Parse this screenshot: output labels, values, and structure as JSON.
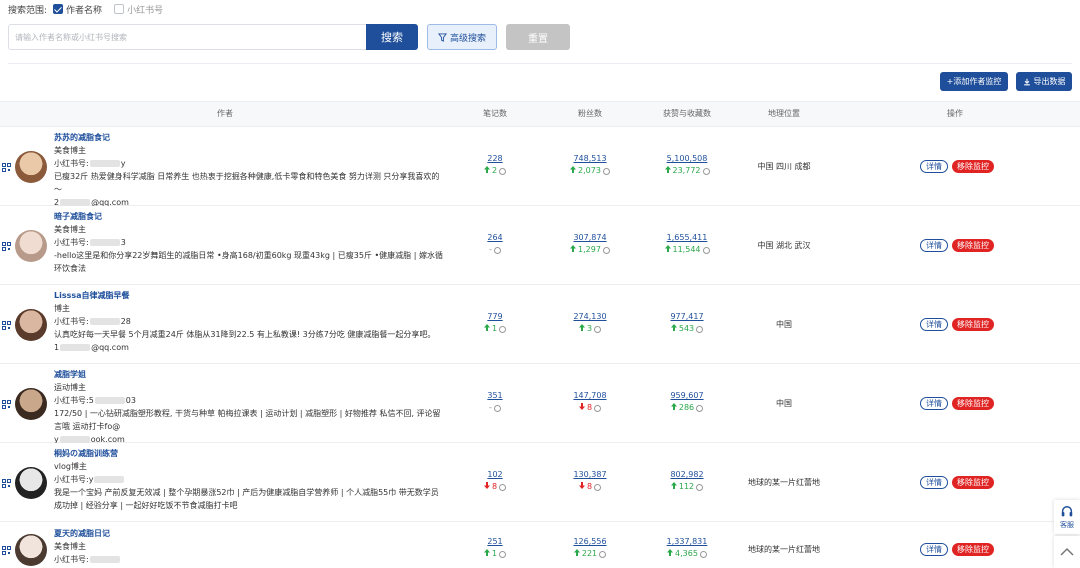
{
  "scope": {
    "label": "搜索范围:",
    "option_author": "作者名称",
    "option_xhs": "小红书号"
  },
  "search": {
    "placeholder": "请输入作者名称或小红书号搜索",
    "search_label": "搜索",
    "advanced_label": "高级搜索",
    "reset_label": "重置"
  },
  "actions": {
    "add_label": "+添加作者监控",
    "export_label": "导出数据"
  },
  "table": {
    "headers": [
      "作者",
      "笔记数",
      "粉丝数",
      "获赞与收藏数",
      "地理位置",
      "操作"
    ],
    "detail_label": "详情",
    "remove_label": "移除监控",
    "rows": [
      {
        "name": "苏苏的减脂食记",
        "type": "美食博主",
        "id_prefix": "小红书号:",
        "id_suffix": "y",
        "bio": "已瘦32斤 热爱健身科学减脂 日常养生 也热衷于挖掘各种健康,低卡零食和特色美食 努力详测 只分享我喜欢的～",
        "email_prefix": "2",
        "email_suffix": "@qq.com",
        "notes": "228",
        "notes_delta": "2",
        "notes_dir": "up",
        "fans": "748,513",
        "fans_delta": "2,073",
        "fans_dir": "up",
        "likes": "5,100,508",
        "likes_delta": "23,772",
        "likes_dir": "up",
        "location": "中国 四川 成都"
      },
      {
        "name": "暗子减脂食记",
        "type": "美食博主",
        "id_prefix": "小红书号:",
        "id_suffix": "3",
        "bio": "-hello这里是和你分享22岁舞蹈生的减脂日常 •身高168/初重60kg 现重43kg | 已瘦35斤 •健康减脂 | 嫁水循环饮食法",
        "email_prefix": "",
        "email_suffix": "",
        "notes": "264",
        "notes_delta": "-",
        "notes_dir": "nil",
        "fans": "307,874",
        "fans_delta": "1,297",
        "fans_dir": "up",
        "likes": "1,655,411",
        "likes_delta": "11,544",
        "likes_dir": "up",
        "location": "中国 湖北 武汉"
      },
      {
        "name": "Lisssa自律减脂早餐",
        "type": "博主",
        "id_prefix": "小红书号:",
        "id_suffix": "28",
        "bio": "认真吃好每一天早餐 5个月减重24斤 体脂从31降到22.5 有上私教课! 3分练7分吃 健康减脂餐一起分享吧。",
        "email_prefix": "1",
        "email_suffix": "@qq.com",
        "notes": "779",
        "notes_delta": "1",
        "notes_dir": "up",
        "fans": "274,130",
        "fans_delta": "3",
        "fans_dir": "up",
        "likes": "977,417",
        "likes_delta": "543",
        "likes_dir": "up",
        "location": "中国"
      },
      {
        "name": "减脂学姐",
        "type": "运动博主",
        "id_prefix": "小红书号:5",
        "id_suffix": "03",
        "bio": "172/50 | 一心钻研减脂塑形教程, 干货与种草 帕梅拉课表 | 运动计划 | 减脂塑形 | 好物推荐 私信不回, 评论留言哦 运动打卡fo@",
        "email_prefix": "y",
        "email_suffix": "ook.com",
        "notes": "351",
        "notes_delta": "-",
        "notes_dir": "nil",
        "fans": "147,708",
        "fans_delta": "8",
        "fans_dir": "down",
        "likes": "959,607",
        "likes_delta": "286",
        "likes_dir": "up",
        "location": "中国"
      },
      {
        "name": "桐妈の减脂训练营",
        "type": "vlog博主",
        "id_prefix": "小红书号:y",
        "id_suffix": "",
        "bio": "我是一个宝妈 产前反复无效减 | 整个孕期暴涨52巾 | 产后为健康减脂自学营养师 | 个人减脂55巾 带无数学员成功掉 | 经验分享 | 一起好好吃饭不节食减脂打卡吧",
        "email_prefix": "",
        "email_suffix": "",
        "notes": "102",
        "notes_delta": "8",
        "notes_dir": "down",
        "fans": "130,387",
        "fans_delta": "8",
        "fans_dir": "down",
        "likes": "802,982",
        "likes_delta": "112",
        "likes_dir": "up",
        "location": "地球的某一片红蕾地"
      },
      {
        "name": "夏天的减脂日记",
        "type": "美食博主",
        "id_prefix": "小红书号:",
        "id_suffix": "",
        "bio": "",
        "email_prefix": "",
        "email_suffix": "",
        "notes": "251",
        "notes_delta": "1",
        "notes_dir": "up",
        "fans": "126,556",
        "fans_delta": "221",
        "fans_dir": "up",
        "likes": "1,337,831",
        "likes_delta": "4,365",
        "likes_dir": "up",
        "location": "地球的某一片红蕾地"
      }
    ]
  },
  "float": {
    "service_label": "客服"
  },
  "colors": {
    "primary": "#1f4f9b",
    "up": "#2aa84a",
    "down": "#e02424"
  }
}
